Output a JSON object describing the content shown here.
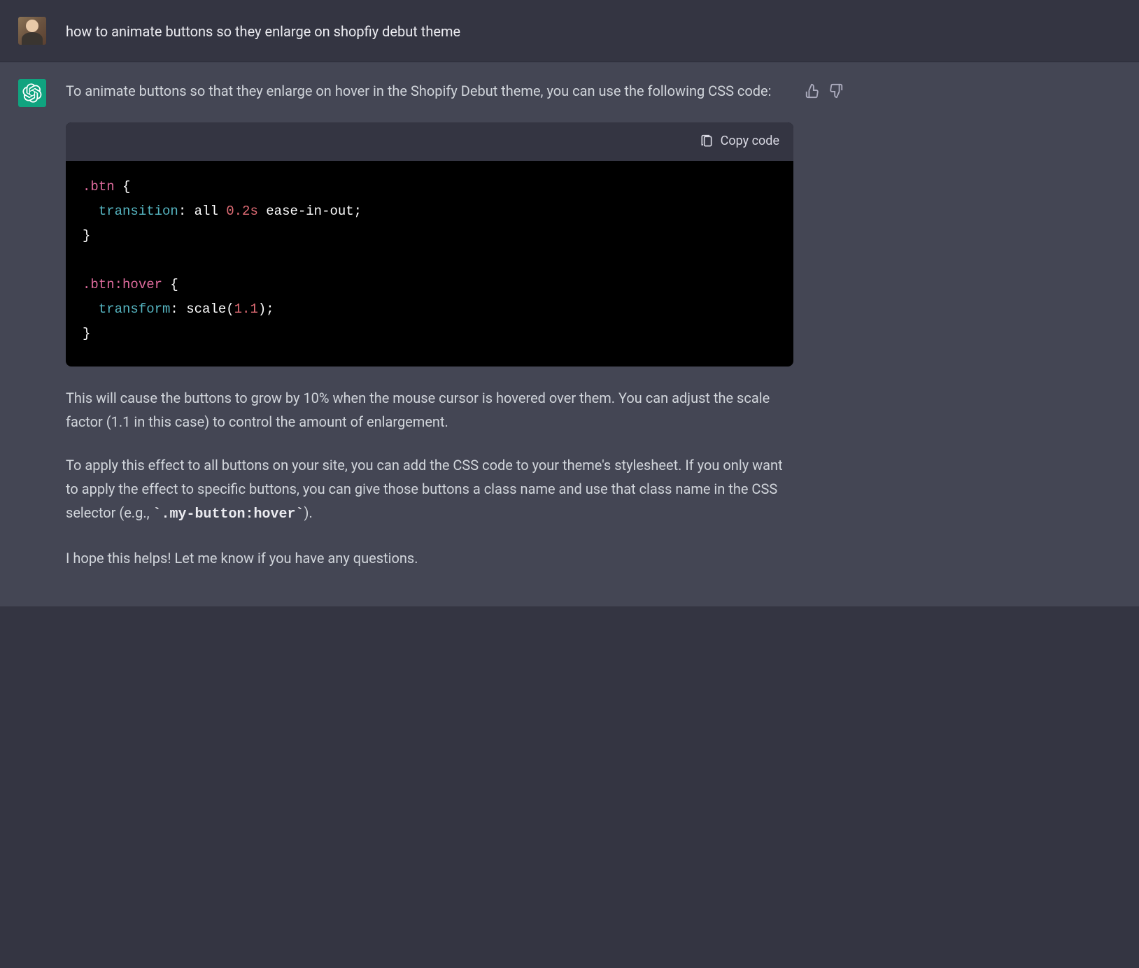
{
  "user": {
    "message": "how to animate buttons so they enlarge on shopfiy debut theme"
  },
  "assistant": {
    "intro": "To animate buttons so that they enlarge on hover in the Shopify Debut theme, you can use the following CSS code:",
    "copy_label": "Copy code",
    "code": {
      "line1_sel": ".btn",
      "brace_open": " {",
      "line2_prop": "  transition",
      "line2_colon": ": ",
      "line2_v1": "all ",
      "line2_v2": "0.2s",
      "line2_v3": " ease-in-out;",
      "brace_close": "}",
      "line4_sel": ".btn:hover",
      "line5_prop": "  transform",
      "line5_colon": ": ",
      "line5_func": "scale(",
      "line5_num": "1.1",
      "line5_end": ");"
    },
    "para1": "This will cause the buttons to grow by 10% when the mouse cursor is hovered over them. You can adjust the scale factor (1.1 in this case) to control the amount of enlargement.",
    "para2_a": "To apply this effect to all buttons on your site, you can add the CSS code to your theme's stylesheet. If you only want to apply the effect to specific buttons, you can give those buttons a class name and use that class name in the CSS selector (e.g., ",
    "para2_code": "`.my-button:hover`",
    "para2_b": ").",
    "para3": "I hope this helps! Let me know if you have any questions."
  }
}
